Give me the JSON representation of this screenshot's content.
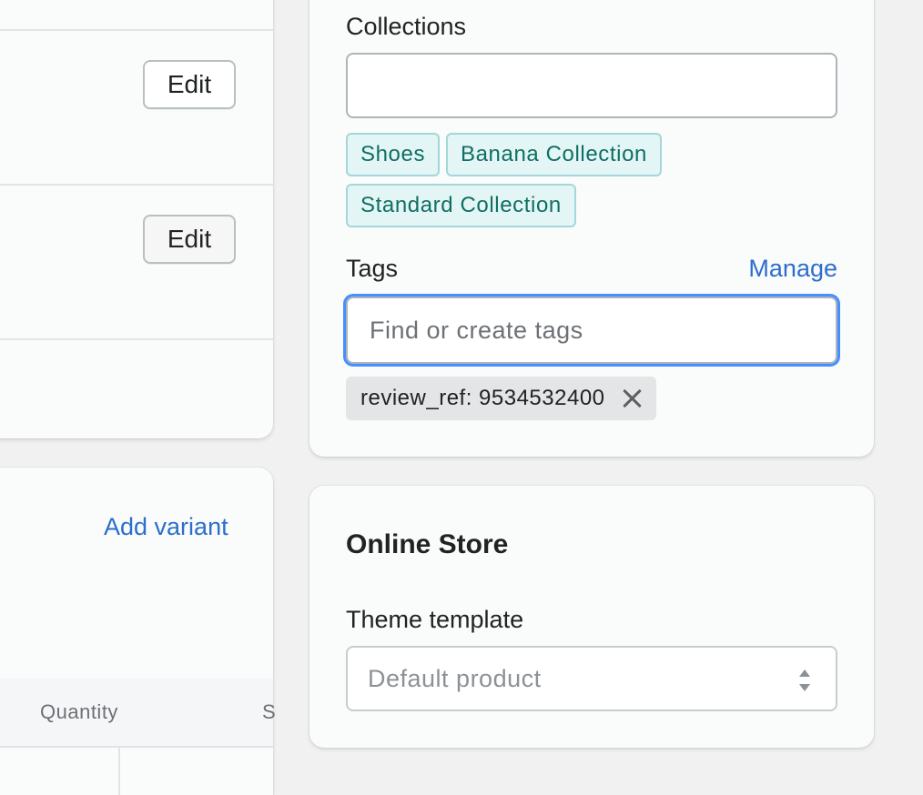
{
  "left_card": {
    "edit_buttons": [
      "Edit",
      "Edit"
    ]
  },
  "variants_card": {
    "add_variant_label": "Add variant",
    "columns": [
      "Quantity",
      "S"
    ]
  },
  "organization": {
    "collections_label": "Collections",
    "collections_value": "",
    "collections": [
      "Shoes",
      "Banana Collection",
      "Standard Collection"
    ],
    "tags_label": "Tags",
    "manage_label": "Manage",
    "tags_placeholder": "Find or create tags",
    "tags": [
      "review_ref: 9534532400"
    ]
  },
  "online_store": {
    "heading": "Online Store",
    "theme_template_label": "Theme template",
    "theme_template_value": "Default product"
  },
  "colors": {
    "link": "#2c6ecb",
    "chip_bg": "#e4f5f5",
    "chip_text": "#0f6f63",
    "focus_ring": "#458fff"
  }
}
